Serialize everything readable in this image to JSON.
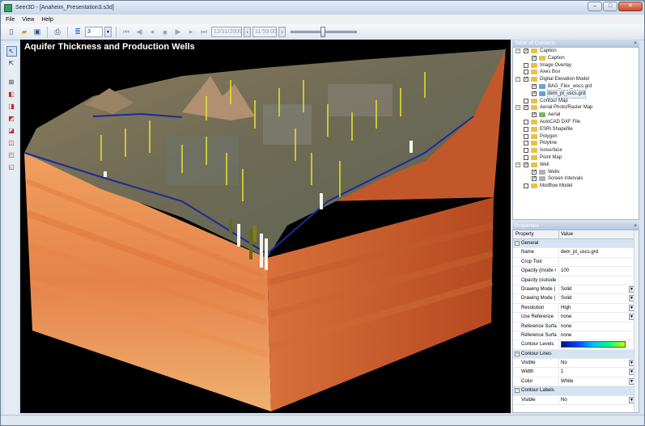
{
  "window": {
    "title": "Seer3D - [Anaheim_Presentation3.s3d]",
    "buttons": [
      "–",
      "□",
      "✕"
    ]
  },
  "menu": [
    "File",
    "View",
    "Help"
  ],
  "toolbar": {
    "layer_value": "3",
    "date_value": "12/31/2009",
    "time_value": "11:59:00"
  },
  "viewport": {
    "title": "Aquifer Thickness and Production Wells"
  },
  "toc": {
    "title": "Table of Contents",
    "items": [
      {
        "label": "Caption",
        "indent": 0,
        "checked": true,
        "expander": "−",
        "icon": "folder"
      },
      {
        "label": "Caption",
        "indent": 1,
        "checked": true,
        "expander": "",
        "icon": "folder"
      },
      {
        "label": "Image Overlay",
        "indent": 0,
        "checked": false,
        "expander": "",
        "icon": "folder"
      },
      {
        "label": "Axes Box",
        "indent": 0,
        "checked": false,
        "expander": "",
        "icon": "folder"
      },
      {
        "label": "Digital Elevation Model",
        "indent": 0,
        "checked": true,
        "expander": "−",
        "icon": "folder"
      },
      {
        "label": "BAG_Flex_wscs.grd",
        "indent": 1,
        "checked": true,
        "expander": "",
        "icon": "grid"
      },
      {
        "label": "dem_pt_uscs.grd",
        "indent": 1,
        "checked": true,
        "expander": "",
        "icon": "grid",
        "selected": true
      },
      {
        "label": "Contour Map",
        "indent": 0,
        "checked": false,
        "expander": "",
        "icon": "folder"
      },
      {
        "label": "Aerial Photo/Raster Map",
        "indent": 0,
        "checked": true,
        "expander": "−",
        "icon": "folder"
      },
      {
        "label": "Aerial",
        "indent": 1,
        "checked": true,
        "expander": "",
        "icon": "image"
      },
      {
        "label": "AutoCAD DXF File",
        "indent": 0,
        "checked": false,
        "expander": "",
        "icon": "folder"
      },
      {
        "label": "ESRI Shapefile",
        "indent": 0,
        "checked": false,
        "expander": "",
        "icon": "folder"
      },
      {
        "label": "Polygon",
        "indent": 0,
        "checked": false,
        "expander": "",
        "icon": "folder"
      },
      {
        "label": "Polyline",
        "indent": 0,
        "checked": false,
        "expander": "",
        "icon": "folder"
      },
      {
        "label": "Isosurface",
        "indent": 0,
        "checked": false,
        "expander": "",
        "icon": "folder"
      },
      {
        "label": "Point Map",
        "indent": 0,
        "checked": false,
        "expander": "",
        "icon": "folder"
      },
      {
        "label": "Well",
        "indent": 0,
        "checked": true,
        "expander": "−",
        "icon": "folder"
      },
      {
        "label": "Wells",
        "indent": 1,
        "checked": true,
        "expander": "",
        "icon": "well"
      },
      {
        "label": "Screen Intervals",
        "indent": 1,
        "checked": true,
        "expander": "",
        "icon": "well"
      },
      {
        "label": "Modflow Model",
        "indent": 0,
        "checked": false,
        "expander": "",
        "icon": "folder"
      }
    ]
  },
  "properties": {
    "title": "Properties",
    "col_property": "Property",
    "col_value": "Value",
    "rows": [
      {
        "type": "cat",
        "name": "General"
      },
      {
        "name": "Name",
        "value": "dem_pt_uscs.grd",
        "dd": false
      },
      {
        "name": "Crop Tool",
        "value": "",
        "dd": false
      },
      {
        "name": "Opacity (inside r",
        "value": "100",
        "dd": false
      },
      {
        "name": "Opacity (outside",
        "value": "",
        "dd": false
      },
      {
        "name": "Drawing Mode (",
        "value": "Solid",
        "dd": true
      },
      {
        "name": "Drawing Mode (",
        "value": "Solid",
        "dd": true
      },
      {
        "name": "Resolution",
        "value": "High",
        "dd": true
      },
      {
        "name": "Use Reference",
        "value": "none",
        "dd": true
      },
      {
        "name": "Reference Surfa",
        "value": "none",
        "dd": false
      },
      {
        "name": "Reference Surfa",
        "value": "none",
        "dd": false
      },
      {
        "name": "Contour Levels",
        "value": "",
        "dd": false
      },
      {
        "type": "cat",
        "name": "Contour Lines"
      },
      {
        "name": "Visible",
        "value": "No",
        "dd": true
      },
      {
        "name": "Width",
        "value": "1",
        "dd": true
      },
      {
        "name": "Color",
        "value": "White",
        "dd": true
      },
      {
        "type": "cat",
        "name": "Contour Labels"
      },
      {
        "name": "Visible",
        "value": "No",
        "dd": true
      }
    ]
  },
  "colors": {
    "stratum_front": [
      "#f4a35e",
      "#ee9252",
      "#e47d43",
      "#d86a37",
      "#cc5a2e"
    ],
    "stratum_side": [
      "#e7864a",
      "#df763f",
      "#d26434",
      "#c5552b",
      "#b84a24"
    ],
    "terrain": "#6d6a52",
    "water": "#1e2a9a"
  },
  "icons": {
    "new": "new-file-icon",
    "open": "open-folder-icon",
    "save": "save-icon",
    "print": "print-icon",
    "layers": "layers-icon",
    "play": "play-icon",
    "stop": "stop-icon",
    "pointer": "pointer-icon"
  }
}
